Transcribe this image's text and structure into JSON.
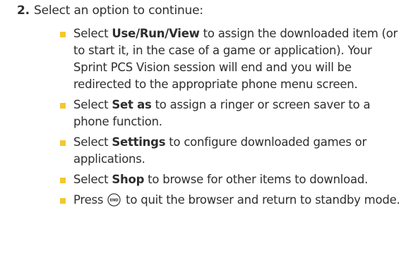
{
  "step": {
    "number": "2.",
    "heading": "Select an option to continue:"
  },
  "options": [
    {
      "prefix": "Select ",
      "keyword": "Use/Run/View",
      "text": " to assign the downloaded item (or to start it, in the case of a game or application). Your Sprint PCS Vision session will end and you will be redirected to the appropriate phone menu screen."
    },
    {
      "prefix": "Select ",
      "keyword": "Set as",
      "text": " to assign a ringer or screen saver to a phone function."
    },
    {
      "prefix": "Select ",
      "keyword": "Settings",
      "text": " to configure downloaded games or applications."
    },
    {
      "prefix": "Select ",
      "keyword": "Shop",
      "text": " to browse for other items to download."
    },
    {
      "prefix": "Press ",
      "icon": "end-key-icon",
      "icon_label": "END",
      "text": " to quit the browser and return to standby mode."
    }
  ],
  "colors": {
    "bullet": "#f5c72b",
    "text": "#2e2e2e"
  }
}
